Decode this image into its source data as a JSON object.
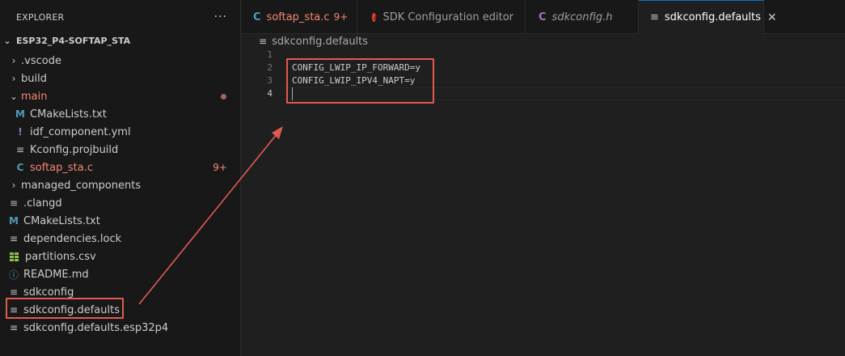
{
  "sidebar": {
    "title": "EXPLORER",
    "more_icon": "···",
    "project": "ESP32_P4-SOFTAP_STA",
    "items": [
      {
        "label": ".vscode"
      },
      {
        "label": "build"
      },
      {
        "label": "main"
      },
      {
        "label": "CMakeLists.txt"
      },
      {
        "label": "idf_component.yml"
      },
      {
        "label": "Kconfig.projbuild"
      },
      {
        "label": "softap_sta.c",
        "badge": "9+"
      },
      {
        "label": "managed_components"
      },
      {
        "label": ".clangd"
      },
      {
        "label": "CMakeLists.txt"
      },
      {
        "label": "dependencies.lock"
      },
      {
        "label": "partitions.csv"
      },
      {
        "label": "README.md"
      },
      {
        "label": "sdkconfig"
      },
      {
        "label": "sdkconfig.defaults"
      },
      {
        "label": "sdkconfig.defaults.esp32p4"
      }
    ]
  },
  "tabs": [
    {
      "icon": "C",
      "label": "softap_sta.c",
      "badge": "9+"
    },
    {
      "label": "SDK Configuration editor"
    },
    {
      "icon": "C",
      "label": "sdkconfig.h"
    },
    {
      "icon": "≡",
      "label": "sdkconfig.defaults",
      "close": "✕"
    }
  ],
  "breadcrumb": {
    "icon": "≡",
    "label": "sdkconfig.defaults"
  },
  "editor": {
    "line_numbers": [
      "1",
      "2",
      "3",
      "4"
    ],
    "lines": [
      "",
      "CONFIG_LWIP_IP_FORWARD=y",
      "CONFIG_LWIP_IPV4_NAPT=y",
      ""
    ]
  },
  "icons": {
    "chevron_right": "›",
    "chevron_down": "⌄",
    "cmake": "M",
    "yaml": "!",
    "c_file": "C",
    "text_file": "≡",
    "info": "ⓘ"
  },
  "colors": {
    "annotation": "#e05a52",
    "modified": "#f48771",
    "accent": "#0078d4"
  }
}
